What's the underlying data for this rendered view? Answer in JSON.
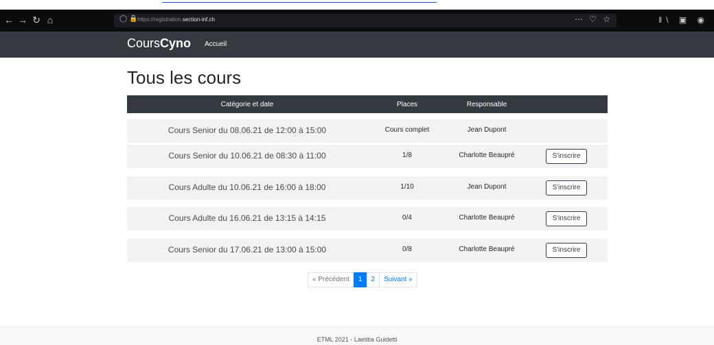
{
  "browser": {
    "url_prefix": "https://registration.",
    "url_domain": "section-inf.ch",
    "nav_icons": [
      "back-icon",
      "forward-icon",
      "reload-icon",
      "home-icon"
    ]
  },
  "app": {
    "brand_light": "Cours",
    "brand_bold": "Cyno",
    "nav_home": "Accueil"
  },
  "page": {
    "title": "Tous les cours"
  },
  "table": {
    "headers": [
      "Catégorie et date",
      "Places",
      "Responsable",
      ""
    ],
    "rows": [
      {
        "course": "Cours Senior du 08.06.21 de 12:00 à 15:00",
        "places": "Cours complet",
        "manager": "Jean Dupont",
        "action": ""
      },
      {
        "course": "Cours Senior du 10.06.21 de 08:30 à 11:00",
        "places": "1/8",
        "manager": "Charlotte Beaupré",
        "action": "S'inscrire"
      },
      {
        "course": "Cours Adulte du 10.06.21 de 16:00 à 18:00",
        "places": "1/10",
        "manager": "Jean Dupont",
        "action": "S'inscrire"
      },
      {
        "course": "Cours Adulte du 16.06.21 de 13:15 à 14:15",
        "places": "0/4",
        "manager": "Charlotte Beaupré",
        "action": "S'inscrire"
      },
      {
        "course": "Cours Senior du 17.06.21 de 13:00 à 15:00",
        "places": "0/8",
        "manager": "Charlotte Beaupré",
        "action": "S'inscrire"
      }
    ]
  },
  "pagination": {
    "prev": "« Précédent",
    "pages": [
      "1",
      "2"
    ],
    "current": "1",
    "next": "Suivant »"
  },
  "footer": {
    "text": "ETML 2021 - Laetitia Guidetti"
  },
  "colors": {
    "navbar": "#343a40",
    "primary": "#007bff",
    "row_bg": "#f2f2f2"
  }
}
